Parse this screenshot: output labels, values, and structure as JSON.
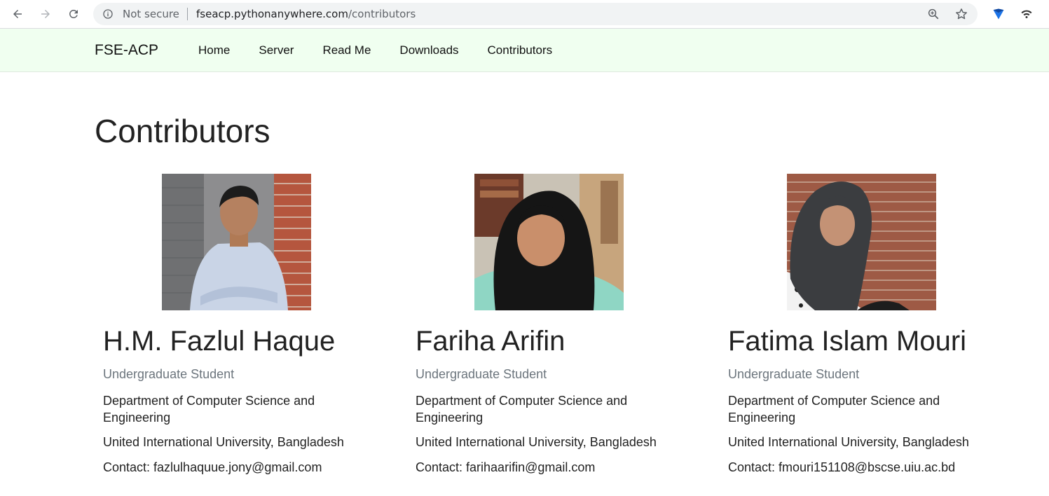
{
  "browser": {
    "security_label": "Not secure",
    "url_host": "fseacp.pythonanywhere.com",
    "url_path": "/contributors"
  },
  "navbar": {
    "brand": "FSE-ACP",
    "links": [
      "Home",
      "Server",
      "Read Me",
      "Downloads",
      "Contributors"
    ]
  },
  "page": {
    "title": "Contributors"
  },
  "contributors": [
    {
      "name": "H.M. Fazlul Haque",
      "role": "Undergraduate Student",
      "department": "Department of Computer Science and Engineering",
      "university": "United International University, Bangladesh",
      "contact": "Contact: fazlulhaquue.jony@gmail.com"
    },
    {
      "name": "Fariha Arifin",
      "role": "Undergraduate Student",
      "department": "Department of Computer Science and Engineering",
      "university": "United International University, Bangladesh",
      "contact": "Contact: farihaarifin@gmail.com"
    },
    {
      "name": "Fatima Islam Mouri",
      "role": "Undergraduate Student",
      "department": "Department of Computer Science and Engineering",
      "university": "United International University, Bangladesh",
      "contact": "Contact: fmouri151108@bscse.uiu.ac.bd"
    }
  ],
  "icons": {
    "back": "arrow-left-icon",
    "forward": "arrow-right-icon",
    "reload": "reload-icon",
    "info": "info-icon",
    "zoom": "zoom-icon",
    "bookmark": "star-icon"
  },
  "colors": {
    "navbar_bg": "#f0fff0",
    "muted_text": "#6c757d"
  }
}
